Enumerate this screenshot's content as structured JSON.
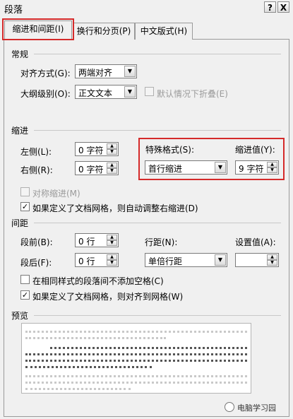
{
  "window": {
    "title": "段落",
    "help_button": "?",
    "close_button": "X"
  },
  "tabs": [
    {
      "label": "缩进和间距(I)",
      "active": true
    },
    {
      "label": "换行和分页(P)",
      "active": false
    },
    {
      "label": "中文版式(H)",
      "active": false
    }
  ],
  "general": {
    "title": "常规",
    "alignment": {
      "label": "对齐方式(G):",
      "value": "两端对齐"
    },
    "outline": {
      "label": "大纲级别(O):",
      "value": "正文文本"
    },
    "collapsed_default": {
      "label": "默认情况下折叠(E)",
      "checked": false,
      "enabled": false
    }
  },
  "indent": {
    "title": "缩进",
    "left": {
      "label": "左侧(L):",
      "value": "0 字符"
    },
    "right": {
      "label": "右侧(R):",
      "value": "0 字符"
    },
    "special": {
      "label": "特殊格式(S):",
      "value": "首行缩进"
    },
    "by": {
      "label": "缩进值(Y):",
      "value": "9 字符"
    },
    "mirror": {
      "label": "对称缩进(M)",
      "checked": false,
      "enabled": false
    },
    "auto_adjust": {
      "label": "如果定义了文档网格，则自动调整右缩进(D)",
      "checked": true
    }
  },
  "spacing": {
    "title": "间距",
    "before": {
      "label": "段前(B):",
      "value": "0 行"
    },
    "after": {
      "label": "段后(F):",
      "value": "0 行"
    },
    "line": {
      "label": "行距(N):",
      "value": "单倍行距"
    },
    "at": {
      "label": "设置值(A):",
      "value": ""
    },
    "no_space_same_style": {
      "label": "在相同样式的段落间不添加空格(C)",
      "checked": false
    },
    "snap_grid": {
      "label": "如果定义了文档网格，则对齐到网格(W)",
      "checked": true
    }
  },
  "preview": {
    "title": "预览"
  },
  "watermark": {
    "text": "电脑学习园"
  },
  "colors": {
    "highlight": "#d52a2a",
    "panel": "#f0f0f0"
  }
}
